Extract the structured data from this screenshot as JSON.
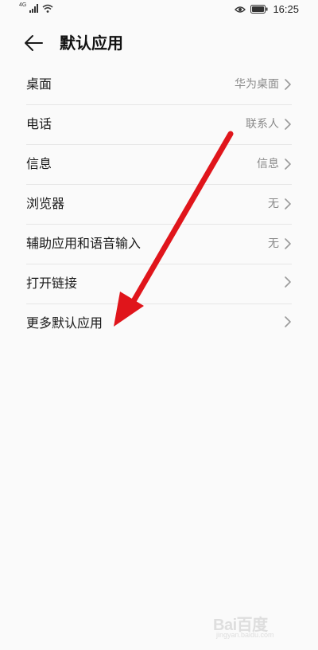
{
  "status_bar": {
    "network_label": "4G",
    "time": "16:25",
    "signal_icon": "signal-bars-icon",
    "wifi_icon": "wifi-icon",
    "eye_icon": "eye-icon",
    "battery_icon": "battery-icon"
  },
  "header": {
    "back_icon": "arrow-left-icon",
    "title": "默认应用"
  },
  "items": [
    {
      "label": "桌面",
      "value": "华为桌面"
    },
    {
      "label": "电话",
      "value": "联系人"
    },
    {
      "label": "信息",
      "value": "信息"
    },
    {
      "label": "浏览器",
      "value": "无"
    },
    {
      "label": "辅助应用和语音输入",
      "value": "无"
    },
    {
      "label": "打开链接",
      "value": ""
    },
    {
      "label": "更多默认应用",
      "value": ""
    }
  ],
  "annotation": {
    "color": "#e0151b"
  },
  "watermark": {
    "logo": "Bai百度",
    "url": "jingyan.baidu.com"
  }
}
